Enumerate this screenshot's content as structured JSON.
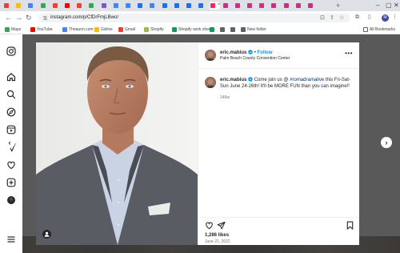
{
  "browser": {
    "tabs": [
      {
        "fav": "#ea4335",
        "active": false
      },
      {
        "fav": "#fbbc05",
        "active": false
      },
      {
        "fav": "#4285f4",
        "active": false
      },
      {
        "fav": "#34a853",
        "active": false
      },
      {
        "fav": "#ea4335",
        "active": false
      },
      {
        "fav": "#ff0000",
        "active": false
      },
      {
        "fav": "#ea4335",
        "active": false
      },
      {
        "fav": "#34a853",
        "active": false
      },
      {
        "fav": "#7e57c2",
        "active": false
      },
      {
        "fav": "#4285f4",
        "active": false
      },
      {
        "fav": "#4285f4",
        "active": false
      },
      {
        "fav": "#1a73e8",
        "active": false
      },
      {
        "fav": "#4285f4",
        "active": false
      },
      {
        "fav": "#1a73e8",
        "active": false
      },
      {
        "fav": "#1a73e8",
        "active": false
      },
      {
        "fav": "#1a73e8",
        "active": false
      },
      {
        "fav": "#1a73e8",
        "active": false
      },
      {
        "fav": "#e1306c",
        "active": true
      },
      {
        "fav": "#c13584",
        "active": false
      },
      {
        "fav": "#c13584",
        "active": false
      },
      {
        "fav": "#c13584",
        "active": false
      },
      {
        "fav": "#c13584",
        "active": false
      },
      {
        "fav": "#c13584",
        "active": false
      },
      {
        "fav": "#c13584",
        "active": false
      },
      {
        "fav": "#c13584",
        "active": false
      },
      {
        "fav": "#c13584",
        "active": false
      }
    ],
    "url": "instagram.com/p/CfDrFmjLBwo/",
    "profile_initial": "M",
    "bookmarks": [
      {
        "label": "Maps",
        "color": "#34a853"
      },
      {
        "label": "YouTube",
        "color": "#ff0000"
      },
      {
        "label": "Theaunn.com",
        "color": "#4285f4"
      },
      {
        "label": "Gdrive",
        "color": "#fbbc05"
      },
      {
        "label": "Gmail",
        "color": "#ea4335"
      },
      {
        "label": "Shopify",
        "color": "#95bf47"
      },
      {
        "label": "Shopify work sheet",
        "color": "#0f9d58"
      },
      {
        "label": "",
        "color": "#0f9d58"
      },
      {
        "label": "",
        "color": "#5f6368"
      },
      {
        "label": "",
        "color": "#5f6368"
      },
      {
        "label": "New folder",
        "color": "#5f6368"
      }
    ],
    "all_bookmarks": "All Bookmarks"
  },
  "post": {
    "username": "eric.mabius",
    "follow_label": "Follow",
    "location": "Palm Beach County Convention Center",
    "caption_prefix": "Come join us @",
    "hashtag": "#romadramalive",
    "caption_suffix": "this Fri-Sat-Sun June 24-26th! It'll be MORE FUN than you can imagine!!",
    "caption_age": "146w",
    "likes": "1,286 likes",
    "date": "June 21, 2022"
  },
  "colors": {
    "accent": "#0095f6",
    "verified": "#0095f6",
    "hashtag": "#00376b"
  }
}
